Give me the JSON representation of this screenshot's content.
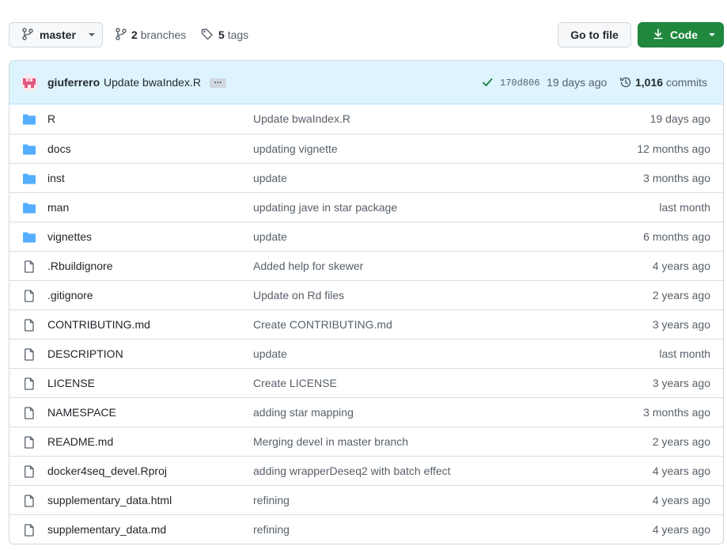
{
  "toolbar": {
    "branch_button": "master",
    "branches": {
      "count": "2",
      "label": "branches"
    },
    "tags": {
      "count": "5",
      "label": "tags"
    },
    "goto_file_button": "Go to file",
    "code_button": "Code"
  },
  "latest_commit": {
    "author": "giuferrero",
    "message": "Update bwaIndex.R",
    "ellipsis": "…",
    "sha": "170d806",
    "time": "19 days ago",
    "commits_count": "1,016",
    "commits_label": "commits"
  },
  "colors": {
    "folder": "#54aeff",
    "file": "#57606a",
    "code_button": "#1f883d",
    "commit_header_bg": "#ddf4ff",
    "check": "#1a7f37"
  },
  "files": [
    {
      "type": "folder",
      "icon": "folder-icon",
      "name": "R",
      "message": "Update bwaIndex.R",
      "age": "19 days ago"
    },
    {
      "type": "folder",
      "icon": "folder-icon",
      "name": "docs",
      "message": "updating vignette",
      "age": "12 months ago"
    },
    {
      "type": "folder",
      "icon": "folder-icon",
      "name": "inst",
      "message": "update",
      "age": "3 months ago"
    },
    {
      "type": "folder",
      "icon": "folder-icon",
      "name": "man",
      "message": "updating jave in star package",
      "age": "last month"
    },
    {
      "type": "folder",
      "icon": "folder-icon",
      "name": "vignettes",
      "message": "update",
      "age": "6 months ago"
    },
    {
      "type": "file",
      "icon": "file-icon",
      "name": ".Rbuildignore",
      "message": "Added help for skewer",
      "age": "4 years ago"
    },
    {
      "type": "file",
      "icon": "file-icon",
      "name": ".gitignore",
      "message": "Update on Rd files",
      "age": "2 years ago"
    },
    {
      "type": "file",
      "icon": "file-icon",
      "name": "CONTRIBUTING.md",
      "message": "Create CONTRIBUTING.md",
      "age": "3 years ago"
    },
    {
      "type": "file",
      "icon": "file-icon",
      "name": "DESCRIPTION",
      "message": "update",
      "age": "last month"
    },
    {
      "type": "file",
      "icon": "file-icon",
      "name": "LICENSE",
      "message": "Create LICENSE",
      "age": "3 years ago"
    },
    {
      "type": "file",
      "icon": "file-icon",
      "name": "NAMESPACE",
      "message": "adding star mapping",
      "age": "3 months ago"
    },
    {
      "type": "file",
      "icon": "file-icon",
      "name": "README.md",
      "message": "Merging devel in master branch",
      "age": "2 years ago"
    },
    {
      "type": "file",
      "icon": "file-icon",
      "name": "docker4seq_devel.Rproj",
      "message": "adding wrapperDeseq2 with batch effect",
      "age": "4 years ago"
    },
    {
      "type": "file",
      "icon": "file-icon",
      "name": "supplementary_data.html",
      "message": "refining",
      "age": "4 years ago"
    },
    {
      "type": "file",
      "icon": "file-icon",
      "name": "supplementary_data.md",
      "message": "refining",
      "age": "4 years ago"
    }
  ]
}
